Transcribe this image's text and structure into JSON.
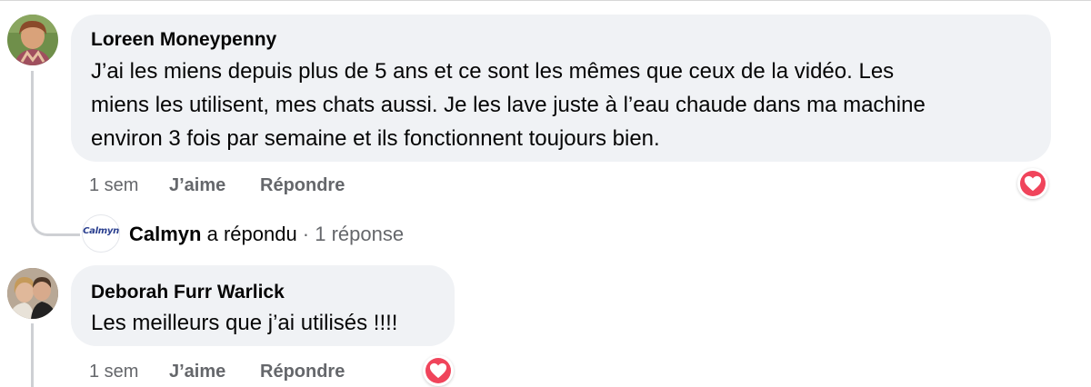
{
  "comments": [
    {
      "author": "Loreen Moneypenny",
      "avatar_icon": "user-avatar",
      "lines": [
        "J’ai les miens depuis plus de 5 ans et ce sont les mêmes que ceux de la vidéo. Les",
        "miens les utilisent, mes chats aussi. Je les lave juste à l’eau chaude dans ma machine",
        "environ 3 fois par semaine et ils fonctionnent toujours bien."
      ],
      "time": "1 sem",
      "like_label": "J’aime",
      "reply_label": "Répondre",
      "reaction_icon": "heart-icon"
    },
    {
      "author": "Deborah Furr Warlick",
      "avatar_icon": "user-avatar",
      "lines": [
        "Les meilleurs que j’ai utilisés !!!!"
      ],
      "time": "1 sem",
      "like_label": "J’aime",
      "reply_label": "Répondre",
      "reaction_icon": "heart-icon"
    }
  ],
  "reply_summary": {
    "logo_text": "Calmyn",
    "name": "Calmyn",
    "action": " a répondu",
    "separator": " · ",
    "count": "1 réponse"
  },
  "colors": {
    "bubble": "#f0f2f5",
    "muted": "#65676b",
    "heart": "#f0445b"
  }
}
